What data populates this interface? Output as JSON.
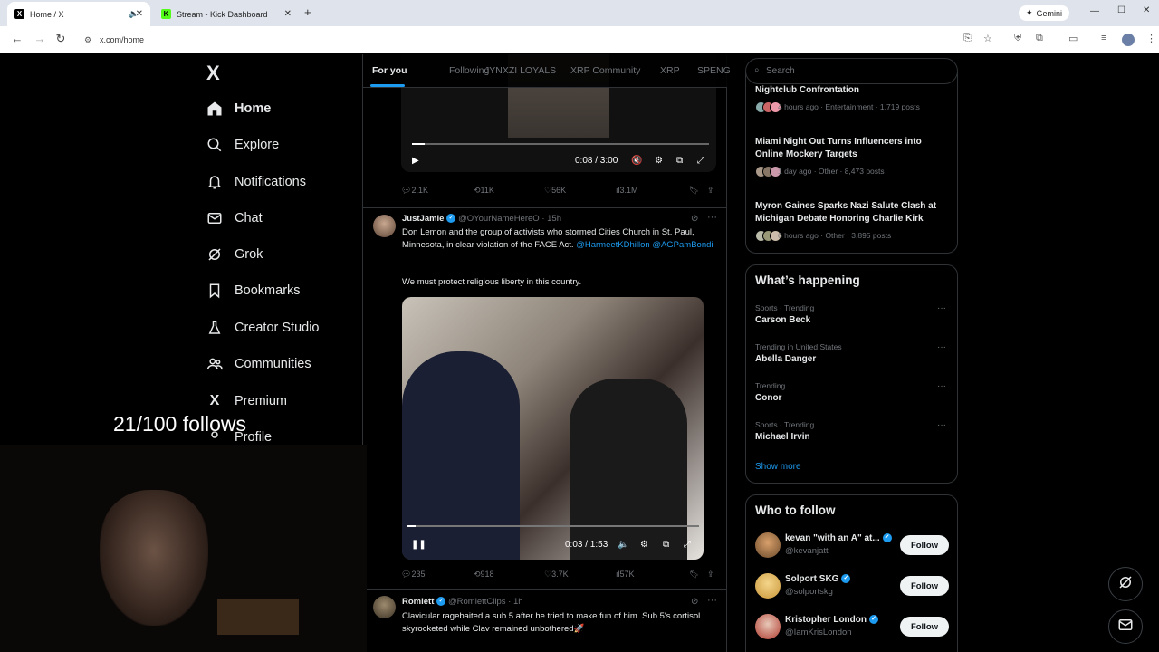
{
  "browser": {
    "tabs": [
      {
        "title": "Home / X",
        "favicon": "X"
      },
      {
        "title": "Stream - Kick Dashboard",
        "favicon": "K"
      }
    ],
    "gemini_label": "Gemini",
    "url": "x.com/home"
  },
  "nav": {
    "logo": "X",
    "items": [
      {
        "label": "Home",
        "icon": "home-icon"
      },
      {
        "label": "Explore",
        "icon": "search-icon"
      },
      {
        "label": "Notifications",
        "icon": "bell-icon"
      },
      {
        "label": "Chat",
        "icon": "mail-icon"
      },
      {
        "label": "Grok",
        "icon": "grok-icon"
      },
      {
        "label": "Bookmarks",
        "icon": "bookmark-icon"
      },
      {
        "label": "Creator Studio",
        "icon": "flask-icon"
      },
      {
        "label": "Communities",
        "icon": "people-icon"
      },
      {
        "label": "Premium",
        "icon": "x-icon"
      },
      {
        "label": "Profile",
        "icon": "person-icon"
      }
    ]
  },
  "timeline": {
    "tabs": [
      "For you",
      "Following",
      "JYNXZI LOYALS",
      "XRP Community",
      "XRP",
      "SPENG"
    ],
    "tweet1": {
      "video_time": "0:08 / 3:00",
      "replies": "2.1K",
      "reposts": "11K",
      "likes": "56K",
      "views": "3.1M"
    },
    "tweet2": {
      "name": "JustJamie",
      "handle": "@OYourNameHereO",
      "time": "· 15h",
      "text": "Don Lemon and the group of activists who stormed Cities Church in St. Paul, Minnesota, in clear violation of the FACE Act.",
      "mention1": "@HarmeetKDhillon",
      "mention2": "@AGPamBondi",
      "text2": "We must protect religious liberty in this country.",
      "video_time": "0:03 / 1:53",
      "replies": "235",
      "reposts": "918",
      "likes": "3.7K",
      "views": "57K"
    },
    "tweet3": {
      "name": "Romlett",
      "handle": "@RomlettClips",
      "time": "· 1h",
      "text": "Clavicular ragebaited a sub 5 after he tried to make fun of him. Sub 5's cortisol skyrocketed while Clav remained unbothered🚀"
    }
  },
  "sidebar": {
    "search_placeholder": "Search",
    "trends": [
      {
        "title": "Nightclub Confrontation",
        "meta": "4 hours ago · Entertainment · 1,719 posts"
      },
      {
        "title": "Miami Night Out Turns Influencers into Online Mockery Targets",
        "meta": "1 day ago · Other · 8,473 posts"
      },
      {
        "title": "Myron Gaines Sparks Nazi Salute Clash at Michigan Debate Honoring Charlie Kirk",
        "meta": "6 hours ago · Other · 3,895 posts"
      }
    ],
    "happening": {
      "title": "What’s happening",
      "items": [
        {
          "category": "Sports · Trending",
          "name": "Carson Beck"
        },
        {
          "category": "Trending in United States",
          "name": "Abella Danger"
        },
        {
          "category": "Trending",
          "name": "Conor"
        },
        {
          "category": "Sports · Trending",
          "name": "Michael Irvin"
        }
      ],
      "show_more": "Show more"
    },
    "who_to_follow": {
      "title": "Who to follow",
      "follow_label": "Follow",
      "accounts": [
        {
          "name": "kevan \"with an A\" at...",
          "handle": "@kevanjatt"
        },
        {
          "name": "Solport SKG",
          "handle": "@solportskg"
        },
        {
          "name": "Kristopher London",
          "handle": "@IamKrisLondon"
        }
      ]
    }
  },
  "overlay": {
    "follows_counter": "21/100 follows"
  },
  "colors": {
    "accent": "#1d9bf0",
    "background": "#000000",
    "border": "#2f3336"
  }
}
